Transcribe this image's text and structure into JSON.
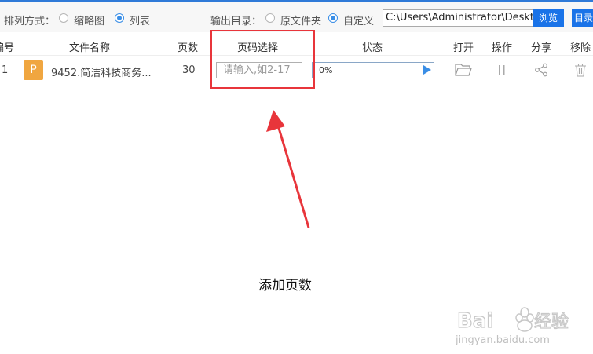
{
  "toolbar": {
    "sort_label": "排列方式：",
    "sort_options": [
      {
        "label": "缩略图",
        "selected": false
      },
      {
        "label": "列表",
        "selected": true
      }
    ],
    "output_label": "输出目录：",
    "output_options": [
      {
        "label": "原文件夹",
        "selected": false
      },
      {
        "label": "自定义",
        "selected": true
      }
    ],
    "output_path": "C:\\Users\\Administrator\\Desktop",
    "browse_label": "浏览",
    "dir_button_label": "目录"
  },
  "table": {
    "columns": [
      "编号",
      "文件名称",
      "页数",
      "页码选择",
      "状态",
      "打开",
      "操作",
      "分享",
      "移除"
    ],
    "rows": [
      {
        "number": "1",
        "file_icon_letter": "P",
        "file_name": "9452.简洁科技商务...",
        "page_count": "30",
        "page_placeholder": "请输入,如2-17",
        "progress_text": "0%",
        "progress": 0
      }
    ]
  },
  "annotation": {
    "caption": "添加页数"
  },
  "watermark": {
    "brand": "Baidu经验",
    "url": "jingyan.baidu.com"
  },
  "colors": {
    "accent": "#1a73e8",
    "highlight": "#e8353b",
    "file_icon": "#f0a640",
    "radio_selected": "#3a8ee6"
  }
}
